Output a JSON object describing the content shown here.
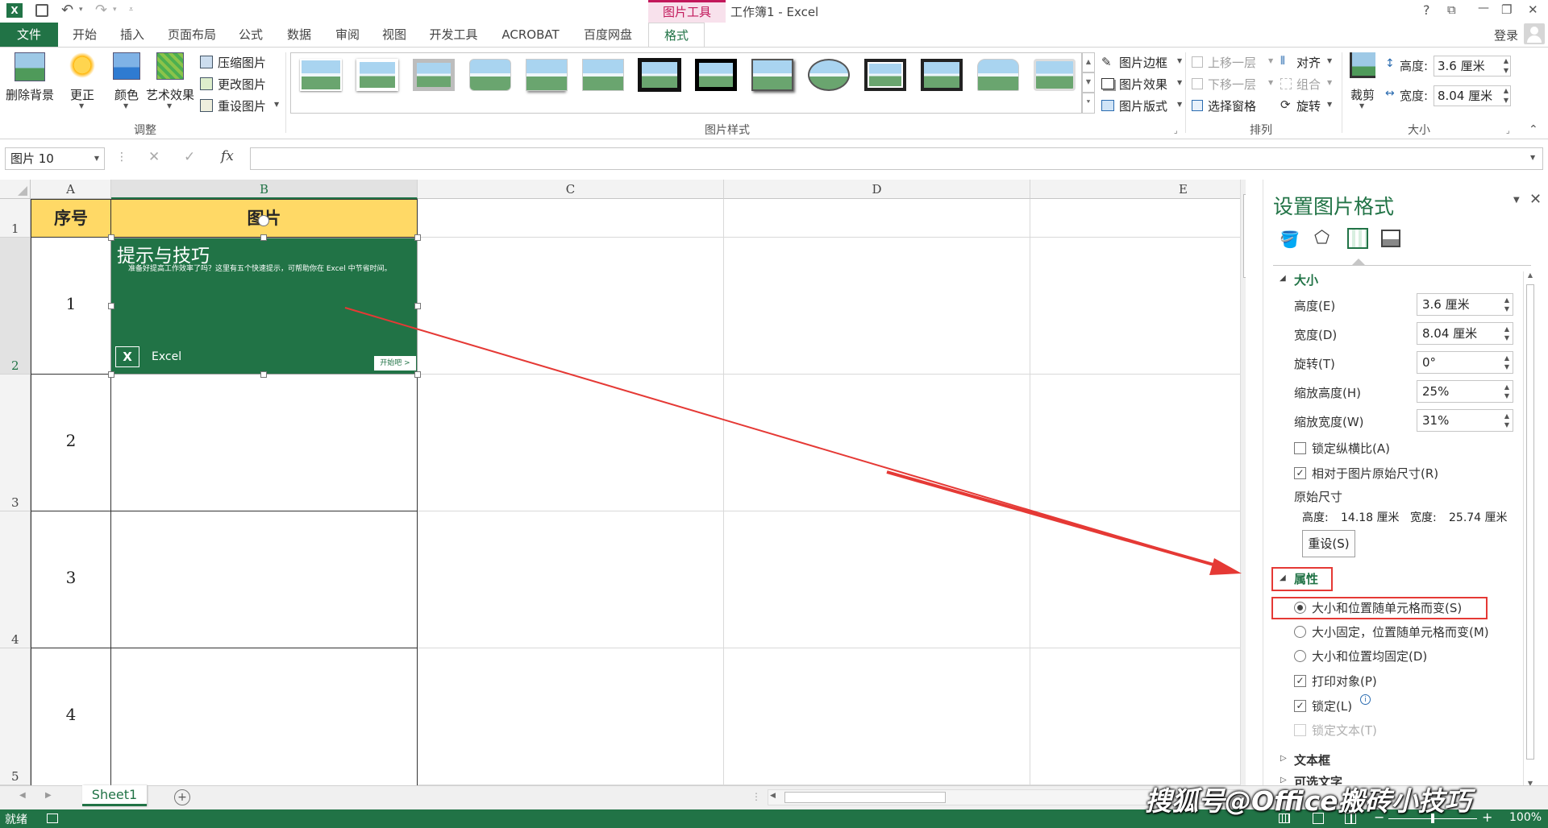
{
  "title": {
    "text": "工作簿1 - Excel",
    "context_tab": "图片工具"
  },
  "title_icons": {
    "help": "?",
    "restore_ribbon": "⧉",
    "minimize": "—",
    "maximize": "❐",
    "close": "✕"
  },
  "tabs": [
    "文件",
    "开始",
    "插入",
    "页面布局",
    "公式",
    "数据",
    "审阅",
    "视图",
    "开发工具",
    "ACROBAT",
    "百度网盘",
    "格式"
  ],
  "login": "登录",
  "ribbon": {
    "adjust": {
      "remove_bg": "删除背景",
      "correct": "更正",
      "color": "颜色",
      "artistic": "艺术效果",
      "compress": "压缩图片",
      "change": "更改图片",
      "reset": "重设图片",
      "group": "调整"
    },
    "styles": {
      "group": "图片样式",
      "border": "图片边框",
      "effects": "图片效果",
      "layout": "图片版式"
    },
    "arrange": {
      "group": "排列",
      "bring_forward": "上移一层",
      "send_backward": "下移一层",
      "selection_pane": "选择窗格",
      "align": "对齐",
      "group_btn": "组合",
      "rotate": "旋转"
    },
    "size": {
      "group": "大小",
      "crop": "裁剪",
      "height_label": "高度:",
      "height_value": "3.6 厘米",
      "width_label": "宽度:",
      "width_value": "8.04 厘米"
    }
  },
  "formula_bar": {
    "name_box": "图片 10",
    "fx": "fx",
    "cancel": "✕",
    "enter": "✓"
  },
  "columns": [
    "A",
    "B",
    "C",
    "D",
    "E"
  ],
  "rows": [
    "1",
    "2",
    "3",
    "4",
    "5"
  ],
  "cells": {
    "a1": "序号",
    "b1": "图片",
    "a2": "1",
    "a3": "2",
    "a4": "3",
    "a5": "4"
  },
  "picture": {
    "title": "提示与技巧",
    "subtitle": "准备好提高工作效率了吗？这里有五个快速提示，可帮助你在 Excel 中节省时间。",
    "brand": "Excel",
    "start_btn": "开始吧 >"
  },
  "pane": {
    "title": "设置图片格式",
    "size_section": "大小",
    "height_label": "高度(E)",
    "height_value": "3.6 厘米",
    "width_label": "宽度(D)",
    "width_value": "8.04 厘米",
    "rotate_label": "旋转(T)",
    "rotate_value": "0°",
    "scale_h_label": "缩放高度(H)",
    "scale_h_value": "25%",
    "scale_w_label": "缩放宽度(W)",
    "scale_w_value": "31%",
    "lock_aspect": "锁定纵横比(A)",
    "relative_original": "相对于图片原始尺寸(R)",
    "original_size": "原始尺寸",
    "orig_height_label": "高度:",
    "orig_height_value": "14.18 厘米",
    "orig_width_label": "宽度:",
    "orig_width_value": "25.74 厘米",
    "reset_btn": "重设(S)",
    "props_section": "属性",
    "opt1": "大小和位置随单元格而变(S)",
    "opt2": "大小固定，位置随单元格而变(M)",
    "opt3": "大小和位置均固定(D)",
    "print_obj": "打印对象(P)",
    "locked": "锁定(L)",
    "lock_text": "锁定文本(T)",
    "textbox_section": "文本框",
    "alt_text_section": "可选文字"
  },
  "sheet_tab": "Sheet1",
  "status": {
    "ready": "就绪",
    "zoom": "100%"
  },
  "watermark": "搜狐号@Office搬砖小技巧",
  "colors": {
    "excel_green": "#217346",
    "header_yellow": "#ffd966",
    "annotation_red": "#e53935",
    "format_tab_pink": "#c2185b"
  }
}
